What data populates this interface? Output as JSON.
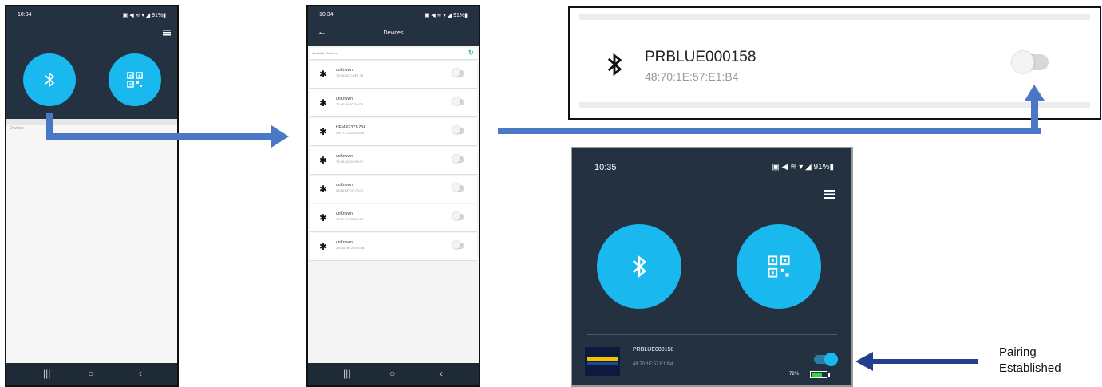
{
  "phone1": {
    "status_time": "10:34",
    "status_right": "▣ ◀ ≋ ▾ ◢ 91%▮",
    "section_label": "Devices",
    "icons": [
      "bluetooth-icon",
      "qr-code-icon",
      "hamburger-menu-icon"
    ]
  },
  "phone2": {
    "status_time": "10:34",
    "status_right": "▣ ◀ ≋ ▾ ◢ 91%▮",
    "title": "Devices",
    "subheader": "Available Devices",
    "devices": [
      {
        "name": "unKnown",
        "mac": "78:43:6D:C4:E7:78"
      },
      {
        "name": "unKnown",
        "mac": "7F:4F:36:7C:86:DF"
      },
      {
        "name": "HEM-6232T-Z3A",
        "mac": "FB:7F:C0:2F:D3:E8"
      },
      {
        "name": "unKnown",
        "mac": "7A:58:5D:2C:9B:3F"
      },
      {
        "name": "unKnown",
        "mac": "36:66:BF:CF:70:0C"
      },
      {
        "name": "unKnown",
        "mac": "75:8F:7F:2D:8A:3C"
      },
      {
        "name": "unKnown",
        "mac": "3B:C8:BF:2E:D6:4B"
      }
    ]
  },
  "zoom": {
    "name": "PRBLUE000158",
    "mac": "48:70:1E:57:E1:B4",
    "toggle_on": false
  },
  "phone3": {
    "status_time": "10:35",
    "status_right": "▣ ◀ ≋ ▾ ◢ 91%▮",
    "device_name": "PRBLUE000158",
    "device_mac": "48:70:1E:57:E1:B4",
    "battery_text": "72%",
    "battery_level": 0.72,
    "toggle_on": true
  },
  "annotation": {
    "line1": "Pairing",
    "line2": "Established"
  },
  "colors": {
    "dark_bg": "#243141",
    "accent": "#19b9f0",
    "arrow_blue": "#4a78c6",
    "arrow_navy": "#233f8e"
  }
}
